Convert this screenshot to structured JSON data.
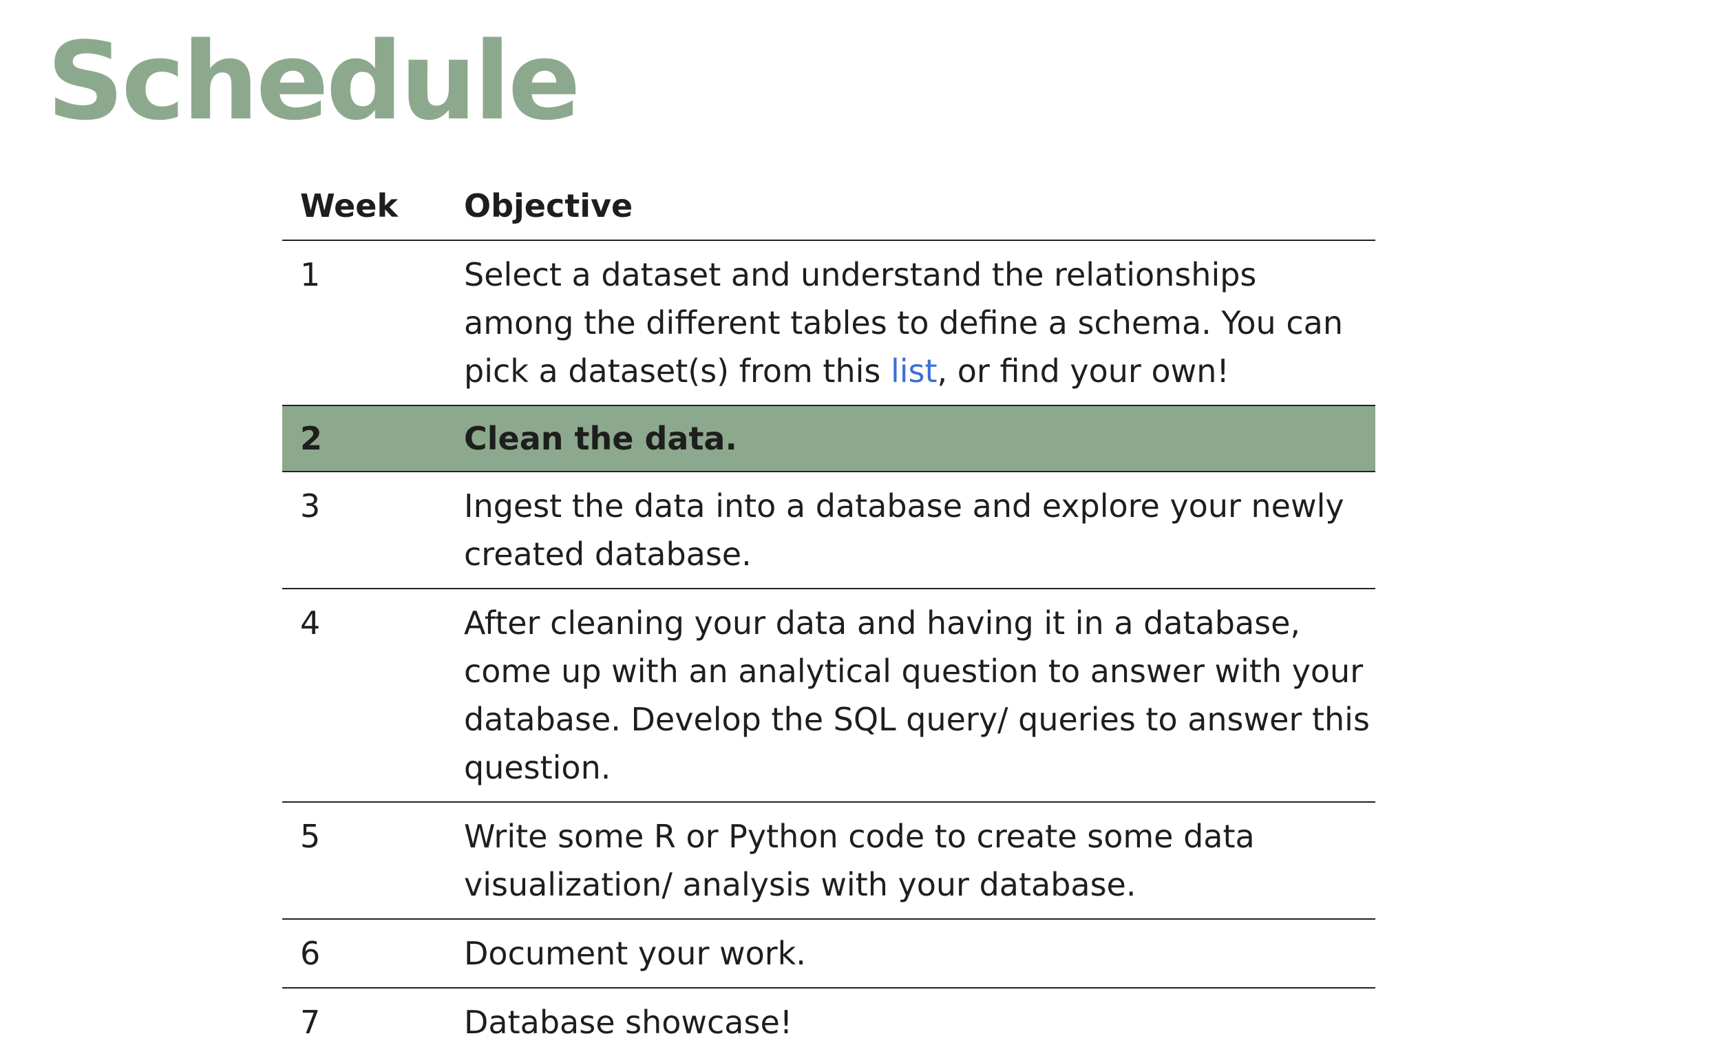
{
  "title": "Schedule",
  "accent_color": "#8da98d",
  "link_color": "#3d6fd6",
  "table": {
    "headers": {
      "week": "Week",
      "objective": "Objective"
    },
    "rows": [
      {
        "week": "1",
        "objective_before": "Select a dataset and understand the relationships among the different tables to define a schema. You can pick a dataset(s) from this ",
        "objective_link": "list",
        "objective_after": ", or find your own!"
      },
      {
        "week": "2",
        "objective": "Clean the data.",
        "highlighted": true
      },
      {
        "week": "3",
        "objective": "Ingest the data into a database and explore your newly created database."
      },
      {
        "week": "4",
        "objective": "After cleaning your data and having it in a database, come up with an analytical question to answer with your database. Develop the SQL query/ queries to answer this question."
      },
      {
        "week": "5",
        "objective": "Write some R or Python code to create some data visualization/ analysis with your database."
      },
      {
        "week": "6",
        "objective": "Document your work."
      },
      {
        "week": "7",
        "objective": "Database showcase!"
      }
    ]
  }
}
